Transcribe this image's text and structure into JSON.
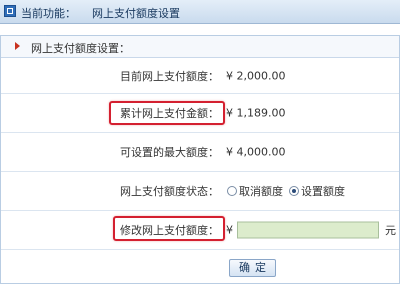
{
  "header": {
    "label": "当前功能：",
    "title": "网上支付额度设置"
  },
  "panel": {
    "title": "网上支付额度设置："
  },
  "rows": [
    {
      "label": "目前网上支付额度：",
      "value": "¥ 2,000.00"
    },
    {
      "label": "累计网上支付金额：",
      "value": "¥ 1,189.00"
    },
    {
      "label": "可设置的最大额度：",
      "value": "¥ 4,000.00"
    },
    {
      "label": "网上支付额度状态："
    },
    {
      "label": "修改网上支付额度："
    }
  ],
  "status_options": [
    {
      "label": "取消额度",
      "selected": false
    },
    {
      "label": "设置额度",
      "selected": true
    }
  ],
  "amount_input": {
    "currency": "¥",
    "value": "",
    "unit": "元"
  },
  "confirm_button": "确定",
  "colors": {
    "highlight": "#d42030",
    "input_bg": "#dceccc",
    "header_bg": "#c9dbee"
  }
}
